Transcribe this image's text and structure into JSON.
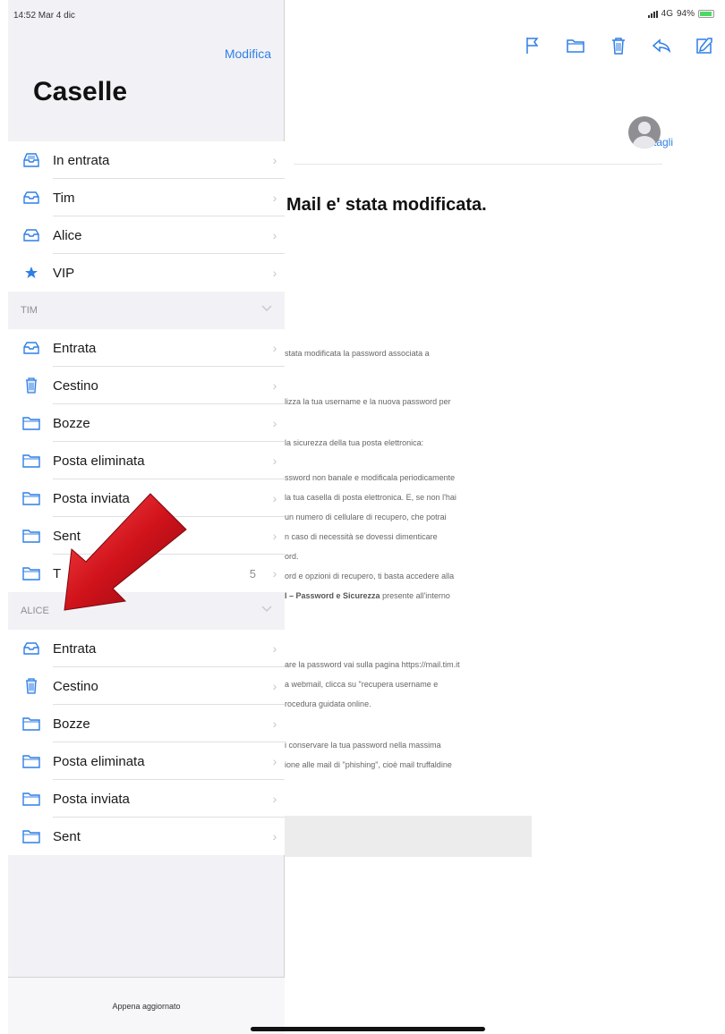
{
  "status": {
    "time_date": "14:52  Mar 4 dic",
    "network": "4G",
    "battery": "94%"
  },
  "sidebar": {
    "edit_label": "Modifica",
    "title": "Caselle",
    "favorites": [
      {
        "label": "In entrata",
        "icon": "inbox-tray-icon"
      },
      {
        "label": "Tim",
        "icon": "tray-icon"
      },
      {
        "label": "Alice",
        "icon": "tray-icon"
      },
      {
        "label": "VIP",
        "icon": "star-icon"
      }
    ],
    "sections": [
      {
        "header": "TIM",
        "items": [
          {
            "label": "Entrata",
            "icon": "tray-icon",
            "count": ""
          },
          {
            "label": "Cestino",
            "icon": "trash-icon",
            "count": ""
          },
          {
            "label": "Bozze",
            "icon": "folder-icon",
            "count": ""
          },
          {
            "label": "Posta eliminata",
            "icon": "folder-icon",
            "count": ""
          },
          {
            "label": "Posta inviata",
            "icon": "folder-icon",
            "count": ""
          },
          {
            "label": "Sent",
            "icon": "folder-icon",
            "count": ""
          },
          {
            "label": "T",
            "icon": "folder-icon",
            "count": "5"
          }
        ]
      },
      {
        "header": "ALICE",
        "items": [
          {
            "label": "Entrata",
            "icon": "tray-icon",
            "count": ""
          },
          {
            "label": "Cestino",
            "icon": "trash-icon",
            "count": ""
          },
          {
            "label": "Bozze",
            "icon": "folder-icon",
            "count": ""
          },
          {
            "label": "Posta eliminata",
            "icon": "folder-icon",
            "count": ""
          },
          {
            "label": "Posta inviata",
            "icon": "folder-icon",
            "count": ""
          },
          {
            "label": "Sent",
            "icon": "folder-icon",
            "count": ""
          }
        ]
      }
    ],
    "footer": "Appena aggiornato"
  },
  "mail": {
    "details_label": "Dettagli",
    "subject": "Mail e' stata modificata.",
    "body_lines_1": [
      {
        "text": "stata modificata la password associata a",
        "bold": ""
      }
    ],
    "body_lines_2": [
      {
        "text": "lizza la tua username e la nuova password per",
        "bold": ""
      }
    ],
    "body_lines_3": [
      {
        "text": "la sicurezza della tua posta elettronica:",
        "bold": ""
      }
    ],
    "body_lines_4": [
      {
        "text": "ssword non banale e modificala periodicamente",
        "bold": ""
      },
      {
        "text": "la tua casella di posta elettronica. E, se non l'hai",
        "bold": ""
      },
      {
        "text": "un numero di cellulare di recupero, che potrai",
        "bold": ""
      },
      {
        "text": "n caso di necessità se dovessi dimenticare",
        "bold": ""
      },
      {
        "text": "ord.",
        "bold": ""
      },
      {
        "text": "ord e opzioni di recupero, ti basta accedere alla",
        "bold": ""
      },
      {
        "text": " presente all'interno",
        "bold": "l – Password e Sicurezza"
      }
    ],
    "body_lines_5": [
      {
        "text": "are la password vai sulla pagina https://mail.tim.it",
        "bold": ""
      },
      {
        "text": "a webmail, clicca su \"recupera username e",
        "bold": ""
      },
      {
        "text": "rocedura guidata online.",
        "bold": ""
      }
    ],
    "body_lines_6": [
      {
        "text": "i conservare la tua password nella massima",
        "bold": ""
      },
      {
        "text": "ione alle mail di \"phishing\", cioè mail truffaldine",
        "bold": ""
      }
    ]
  },
  "colors": {
    "accent": "#2f7fe6",
    "arrow": "#d0121b"
  }
}
